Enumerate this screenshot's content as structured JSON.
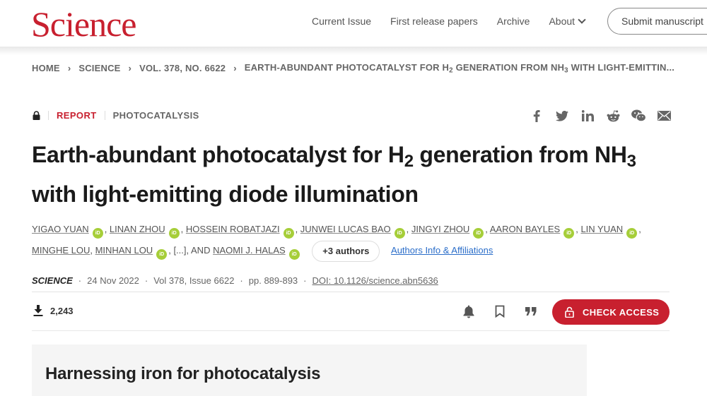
{
  "header": {
    "logo": "Science",
    "nav": [
      {
        "label": "Current Issue"
      },
      {
        "label": "First release papers"
      },
      {
        "label": "Archive"
      },
      {
        "label": "About"
      }
    ],
    "submit_label": "Submit manuscript"
  },
  "breadcrumb": {
    "items": [
      "HOME",
      "SCIENCE",
      "VOL. 378, NO. 6622"
    ],
    "current_prefix": "EARTH-ABUNDANT PHOTOCATALYST FOR H",
    "current_sub1": "2",
    "current_mid": " GENERATION FROM NH",
    "current_sub2": "3",
    "current_suffix": " WITH LIGHT-EMITTIN..."
  },
  "article": {
    "type": "REPORT",
    "category": "PHOTOCATALYSIS",
    "title_part1": "Earth-abundant photocatalyst for H",
    "title_sub1": "2",
    "title_part2": " generation from NH",
    "title_sub2": "3",
    "title_part3": " with light-emitting diode illumination",
    "authors_line1": [
      {
        "name": "YIGAO YUAN",
        "orcid": true
      },
      {
        "name": "LINAN ZHOU",
        "orcid": true
      },
      {
        "name": "HOSSEIN ROBATJAZI",
        "orcid": true
      },
      {
        "name": "JUNWEI LUCAS BAO",
        "orcid": true
      },
      {
        "name": "JINGYI ZHOU",
        "orcid": true
      },
      {
        "name": "AARON BAYLES",
        "orcid": true
      },
      {
        "name": "LIN YUAN",
        "orcid": true
      }
    ],
    "authors_line2": [
      {
        "name": "MINGHE LOU",
        "orcid": false
      },
      {
        "name": "MINHAN LOU",
        "orcid": true
      }
    ],
    "ellipsis": "[...]",
    "and_label": "AND",
    "last_author": "NAOMI J. HALAS",
    "more_authors_label": "+3 authors",
    "affiliations_label": "Authors Info & Affiliations",
    "orcid_label": "iD",
    "journal": "SCIENCE",
    "date": "24 Nov 2022",
    "volume": "Vol 378, Issue 6622",
    "pages": "pp. 889-893",
    "doi": "DOI: 10.1126/science.abn5636",
    "downloads": "2,243",
    "check_access_label": "CHECK ACCESS"
  },
  "summary": {
    "title": "Harnessing iron for photocatalysis"
  },
  "share_icons": [
    "facebook-icon",
    "twitter-icon",
    "linkedin-icon",
    "reddit-icon",
    "wechat-icon",
    "email-icon"
  ],
  "colors": {
    "brand_red": "#c8202f",
    "orcid_green": "#a6ce39",
    "link_blue": "#2a6dc9"
  }
}
